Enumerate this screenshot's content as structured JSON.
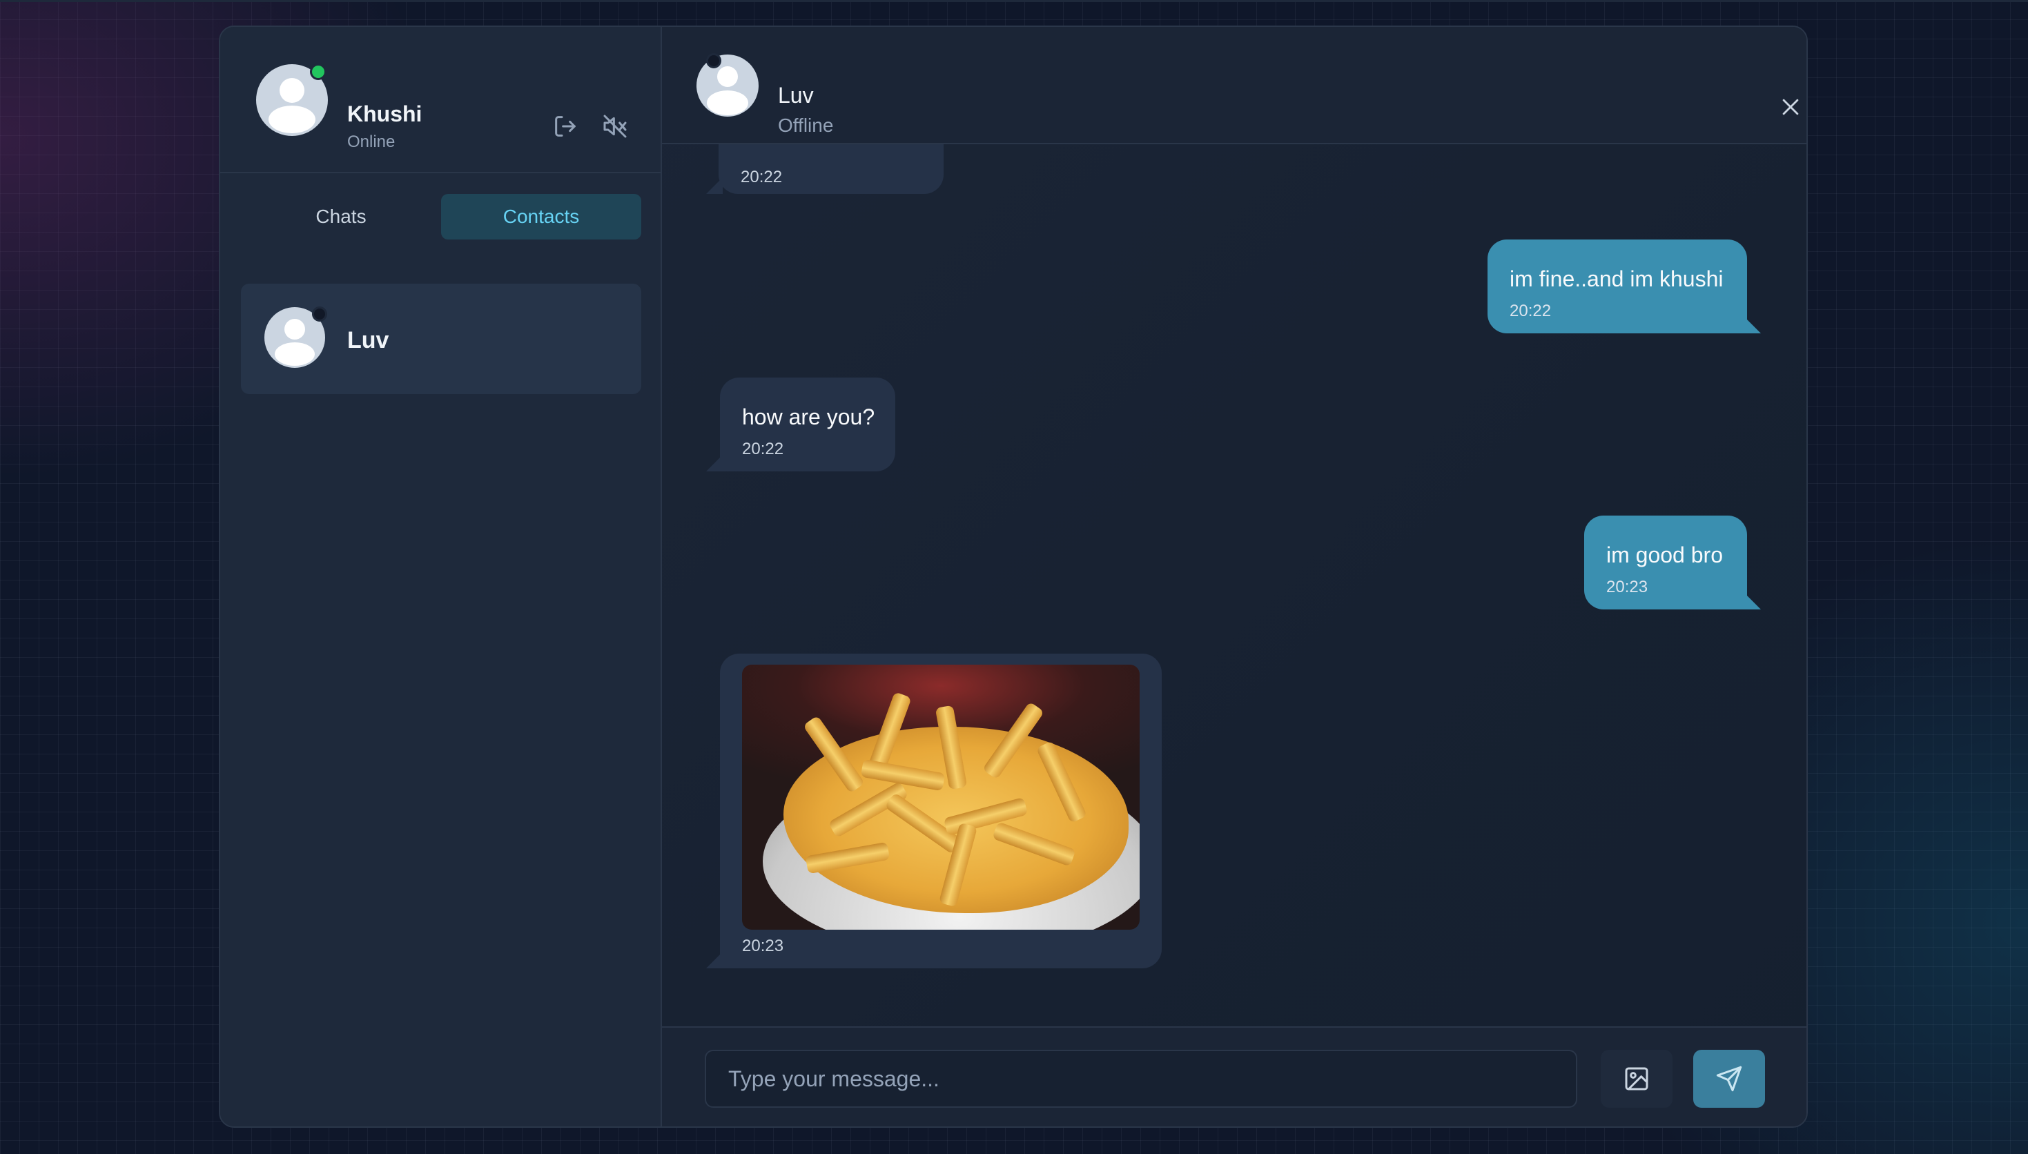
{
  "current_user": {
    "name": "Khushi",
    "status": "Online",
    "status_color": "#22c55e"
  },
  "sidebar": {
    "actions": [
      {
        "icon": "logout-icon"
      },
      {
        "icon": "volume-off-icon"
      }
    ],
    "tabs": [
      {
        "label": "Chats",
        "active": false
      },
      {
        "label": "Contacts",
        "active": true
      }
    ],
    "contacts": [
      {
        "name": "Luv",
        "online": false,
        "selected": true
      }
    ]
  },
  "chat": {
    "contact_name": "Luv",
    "contact_status": "Offline",
    "messages": [
      {
        "direction": "incoming",
        "text": "",
        "time": "20:22"
      },
      {
        "direction": "outgoing",
        "text": "im fine..and im khushi",
        "time": "20:22"
      },
      {
        "direction": "incoming",
        "text": "how are you?",
        "time": "20:22"
      },
      {
        "direction": "outgoing",
        "text": "im good bro",
        "time": "20:23"
      },
      {
        "direction": "incoming",
        "image": "french-fries-photo",
        "time": "20:23"
      }
    ],
    "composer": {
      "placeholder": "Type your message...",
      "value": ""
    }
  },
  "colors": {
    "accent": "#67d3f4",
    "outgoing_bubble": "#3a8fb0",
    "incoming_bubble": "#253248",
    "background": "#0f172a"
  }
}
